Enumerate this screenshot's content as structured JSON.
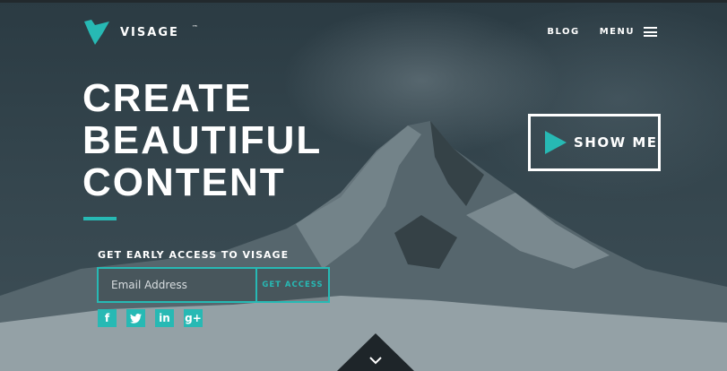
{
  "brand": {
    "name": "VISAGE",
    "tm": "™",
    "accent_color": "#27b9b4"
  },
  "nav": {
    "blog": "BLOG",
    "menu": "MENU"
  },
  "hero": {
    "headline_lines": [
      "CREATE",
      "BEAUTIFUL",
      "CONTENT"
    ],
    "show_me_label": "SHOW ME"
  },
  "signup": {
    "title": "GET EARLY ACCESS TO VISAGE",
    "email_placeholder": "Email Address",
    "button_label": "GET ACCESS"
  },
  "socials": [
    {
      "name": "facebook-icon",
      "glyph": "f"
    },
    {
      "name": "twitter-icon",
      "glyph": "t"
    },
    {
      "name": "linkedin-icon",
      "glyph": "in"
    },
    {
      "name": "google-plus-icon",
      "glyph": "g+"
    }
  ]
}
